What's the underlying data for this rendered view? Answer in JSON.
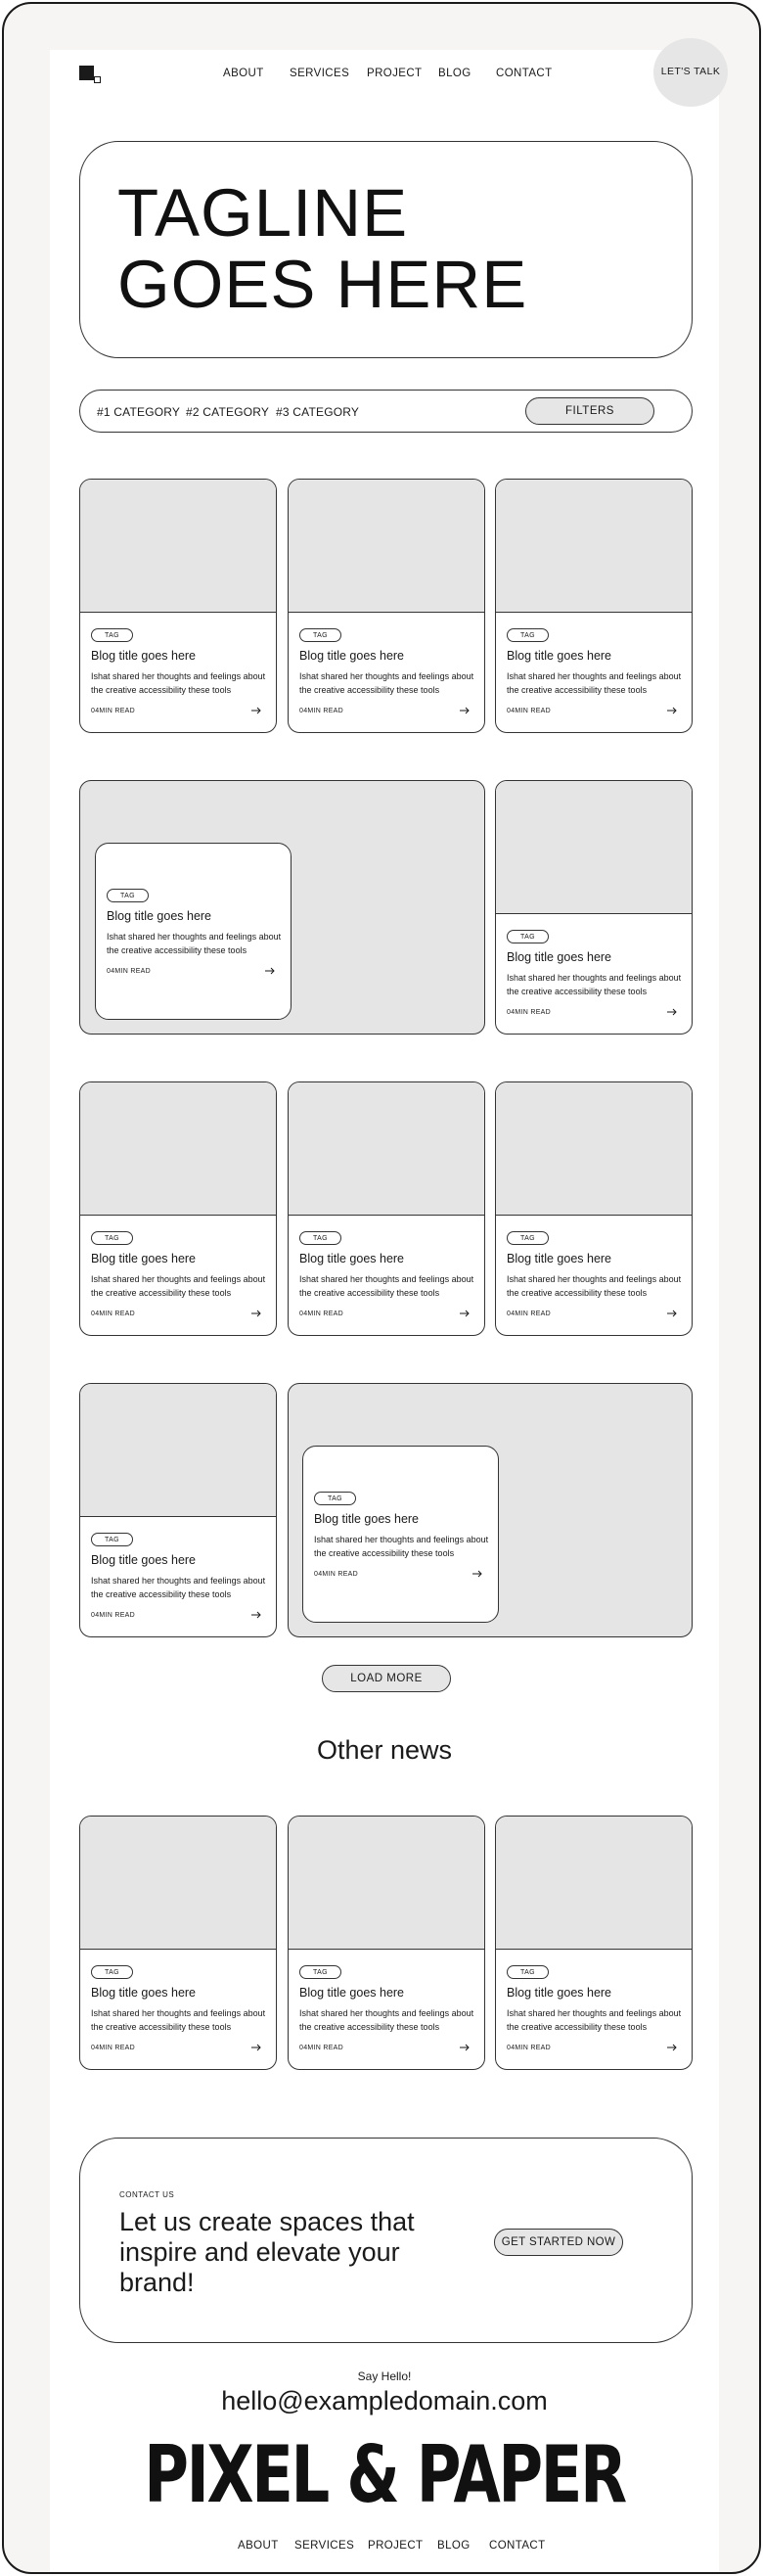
{
  "nav": {
    "links": [
      "ABOUT",
      "SERVICES",
      "PROJECT",
      "BLOG",
      "CONTACT"
    ],
    "cta": "LET'S TALK"
  },
  "hero": {
    "tagline_line1": "TAGLINE",
    "tagline_line2": "GOES HERE"
  },
  "filters": {
    "categories": [
      "#1 CATEGORY",
      "#2 CATEGORY",
      "#3 CATEGORY"
    ],
    "button": "FILTERS"
  },
  "post": {
    "tag": "TAG",
    "title": "Blog title goes here",
    "description": "Ishat shared her thoughts and feelings about the creative accessibility these tools",
    "read_time": "04MIN READ"
  },
  "load_more": "LOAD MORE",
  "other_news": {
    "heading": "Other news"
  },
  "cta": {
    "label": "CONTACT US",
    "heading": "Let us create spaces that inspire and elevate your brand!",
    "button": "GET STARTED NOW"
  },
  "footer": {
    "say_hello": "Say Hello!",
    "email": "hello@exampledomain.com",
    "brand": "PIXEL & PAPER",
    "links": [
      "ABOUT",
      "SERVICES",
      "PROJECT",
      "BLOG",
      "CONTACT"
    ]
  },
  "colors": {
    "placeholder": "#e5e5e5",
    "border": "#333333",
    "background": "#f6f5f3",
    "button_fill": "#e6e6e6"
  },
  "icons": [
    "logo-icon",
    "arrow-right-icon"
  ]
}
